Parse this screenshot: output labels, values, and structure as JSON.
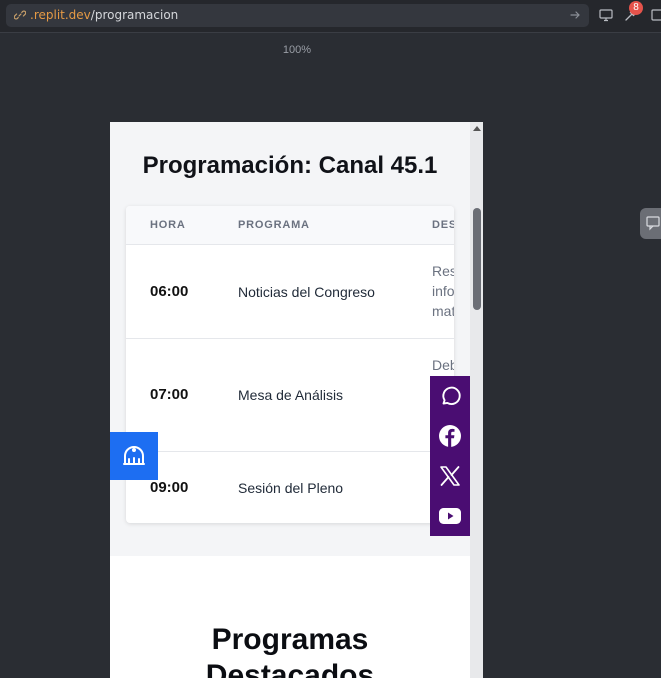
{
  "browser": {
    "url_host": ".replit.dev",
    "url_path": "/programacion",
    "zoom": "100%",
    "badge_count": "8"
  },
  "page": {
    "title": "Programación: Canal 45.1",
    "table": {
      "headers": [
        "HORA",
        "PROGRAMA",
        "DES"
      ],
      "rows": [
        {
          "hora": "06:00",
          "programa": "Noticias del Congreso",
          "descripcion": [
            "Res",
            "info",
            "mat"
          ]
        },
        {
          "hora": "07:00",
          "programa": "Mesa de Análisis",
          "descripcion": [
            "Deb"
          ]
        },
        {
          "hora": "09:00",
          "programa": "Sesión del Pleno",
          "descripcion": []
        }
      ]
    },
    "section_title_line1": "Programas",
    "section_title_line2": "Destacados"
  },
  "social": [
    "whatsapp-icon",
    "facebook-icon",
    "x-icon",
    "youtube-icon"
  ],
  "colors": {
    "accessibility_blue": "#1d6ef2",
    "social_purple": "#4a0d72",
    "url_host_orange": "#e59a45"
  }
}
